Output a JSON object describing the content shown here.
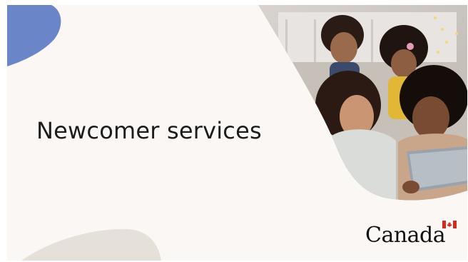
{
  "slide": {
    "title": "Newcomer services"
  },
  "brand": {
    "wordmark": "Canada"
  },
  "colors": {
    "background": "#fbf7f4",
    "blob_blue": "#6a86c9",
    "blob_beige": "#e6e0db",
    "flag_red": "#d52b1e",
    "text": "#1c1c1c"
  },
  "icons": {
    "flag": "canada-flag-icon"
  }
}
